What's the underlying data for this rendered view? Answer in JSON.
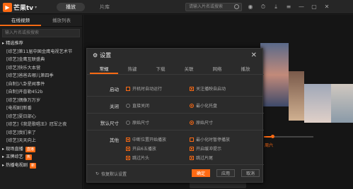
{
  "app": {
    "title": "芒果tv",
    "logo_mark": "▶",
    "logo_caret": "▾"
  },
  "topbar": {
    "tabs": [
      "播放",
      "片库"
    ],
    "search_placeholder": "请输入片名或搜索",
    "icons": [
      "user-icon",
      "history-icon",
      "download-icon",
      "menu-icon",
      "minimize-icon",
      "maximize-icon",
      "close-icon"
    ],
    "icon_glyphs": [
      "◉",
      "⏱",
      "⤓",
      "≡",
      "—",
      "▢",
      "✕"
    ]
  },
  "sidebar": {
    "tabs": [
      "在线视频",
      "播放列表"
    ],
    "search_placeholder": "输入片名或按搜索",
    "items": [
      {
        "label": "精选推荐",
        "head": true
      },
      {
        "label": "[综艺]第11届中国金鹰电视艺术节"
      },
      {
        "label": "[综艺]金鹰互联盛典"
      },
      {
        "label": "[综艺]快乐大本营"
      },
      {
        "label": "[综艺]爸爸去哪儿第四季"
      },
      {
        "label": "[自制]八卦星闻事件"
      },
      {
        "label": "[自制]开普勒452b"
      },
      {
        "label": "[综艺]偶像万万岁"
      },
      {
        "label": "[电视剧]新番"
      },
      {
        "label": "[综艺]夏日部心"
      },
      {
        "label": "[综艺]《我是歌唱王》冠军之夜"
      },
      {
        "label": "[综艺]我们来了"
      },
      {
        "label": "[综艺]天天向上"
      },
      {
        "label": "现场直播",
        "head": true,
        "badge": "直播"
      },
      {
        "label": "王牌综艺",
        "head": true,
        "badge": "热"
      },
      {
        "label": "热播电视剧",
        "head": true,
        "badge": "新"
      }
    ]
  },
  "main": {
    "controls": "■ ◀ ▶",
    "date_label": "周六"
  },
  "dialog": {
    "title": "设置",
    "gear": "⚙",
    "close": "✕",
    "tabs": [
      "常规",
      "热键",
      "下载",
      "关联",
      "网络",
      "播放"
    ],
    "rows": {
      "startup": {
        "label": "启动",
        "opt1": "开机时自动运行",
        "opt2": "关注播映自启动"
      },
      "close": {
        "label": "关闭",
        "opt1": "直接关闭",
        "opt2": "最小化托盘"
      },
      "size": {
        "label": "默认尺寸",
        "opt1": "原始尺寸",
        "opt2": "原始尺寸"
      },
      "other": {
        "label": "其他",
        "opt1": "中断位置开始播放",
        "opt2": "最小化时暂停播放",
        "opt3": "开启6五播放",
        "opt4": "开启缓冲提示",
        "opt5": "跳过片头",
        "opt6": "跳过片尾"
      }
    },
    "restore": "恢复默认设置",
    "buttons": {
      "ok": "确定",
      "apply": "应用",
      "cancel": "取消"
    }
  }
}
